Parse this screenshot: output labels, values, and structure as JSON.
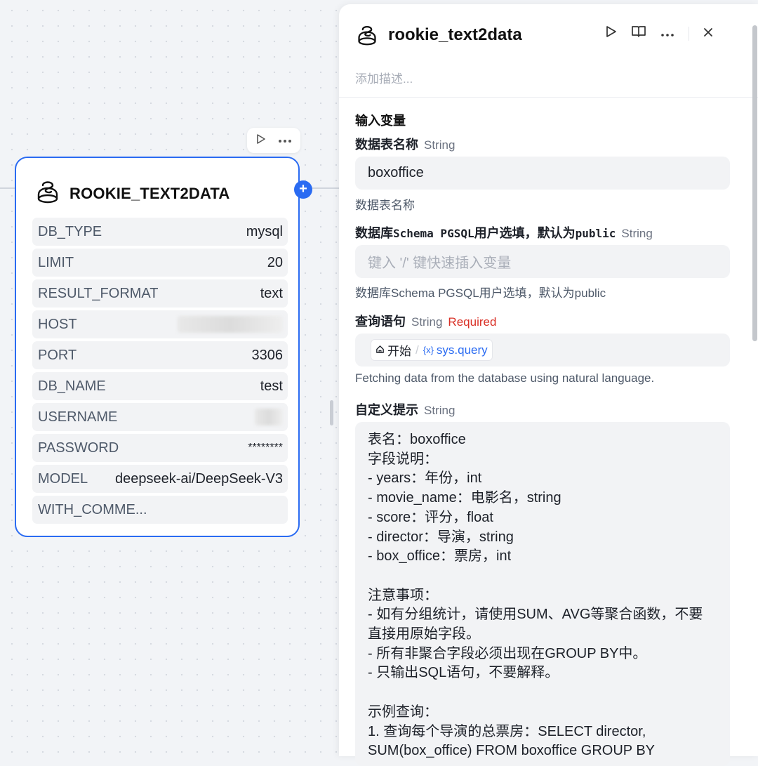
{
  "node": {
    "title": "ROOKIE_TEXT2DATA",
    "toolbar": {
      "run_icon": "play-icon",
      "more_icon": "more-icon"
    },
    "params": [
      {
        "key": "DB_TYPE",
        "value": "mysql"
      },
      {
        "key": "LIMIT",
        "value": "20"
      },
      {
        "key": "RESULT_FORMAT",
        "value": "text"
      },
      {
        "key": "HOST",
        "value": "",
        "redacted": true
      },
      {
        "key": "PORT",
        "value": "3306"
      },
      {
        "key": "DB_NAME",
        "value": "test"
      },
      {
        "key": "USERNAME",
        "value": "",
        "redacted": true
      },
      {
        "key": "PASSWORD",
        "value": "********"
      },
      {
        "key": "MODEL",
        "value": "deepseek-ai/DeepSeek-V3"
      },
      {
        "key": "WITH_COMME...",
        "value": ""
      }
    ]
  },
  "panel": {
    "title": "rookie_text2data",
    "description_placeholder": "添加描述...",
    "section_title": "输入变量",
    "fields": {
      "table_name": {
        "label": "数据表名称",
        "type": "String",
        "value": "boxoffice",
        "help": "数据表名称"
      },
      "schema": {
        "label_prefix": "数据库",
        "label_mono": "Schema PGSQL",
        "label_mid": "用户选填，默认为",
        "label_mono2": "public",
        "type": "String",
        "placeholder": "键入 '/' 键快速插入变量",
        "help": "数据库Schema PGSQL用户选填，默认为public"
      },
      "query": {
        "label": "查询语句",
        "type": "String",
        "required": "Required",
        "chip_node": "开始",
        "chip_var": "sys.query",
        "help": "Fetching data from the database using natural language."
      },
      "prompt": {
        "label": "自定义提示",
        "type": "String",
        "lines": [
          "表名：boxoffice",
          "字段说明：",
          "- years：年份，int",
          "- movie_name：电影名，string",
          "- score：评分，float",
          "- director：导演，string",
          "- box_office：票房，int",
          "",
          "注意事项：",
          "- 如有分组统计，请使用SUM、AVG等聚合函数，不要",
          "直接用原始字段。",
          "- 所有非聚合字段必须出现在GROUP BY中。",
          "- 只输出SQL语句，不要解释。",
          "",
          "示例查询：",
          "1. 查询每个导演的总票房：SELECT director,",
          "SUM(box_office) FROM boxoffice GROUP BY"
        ]
      }
    }
  }
}
